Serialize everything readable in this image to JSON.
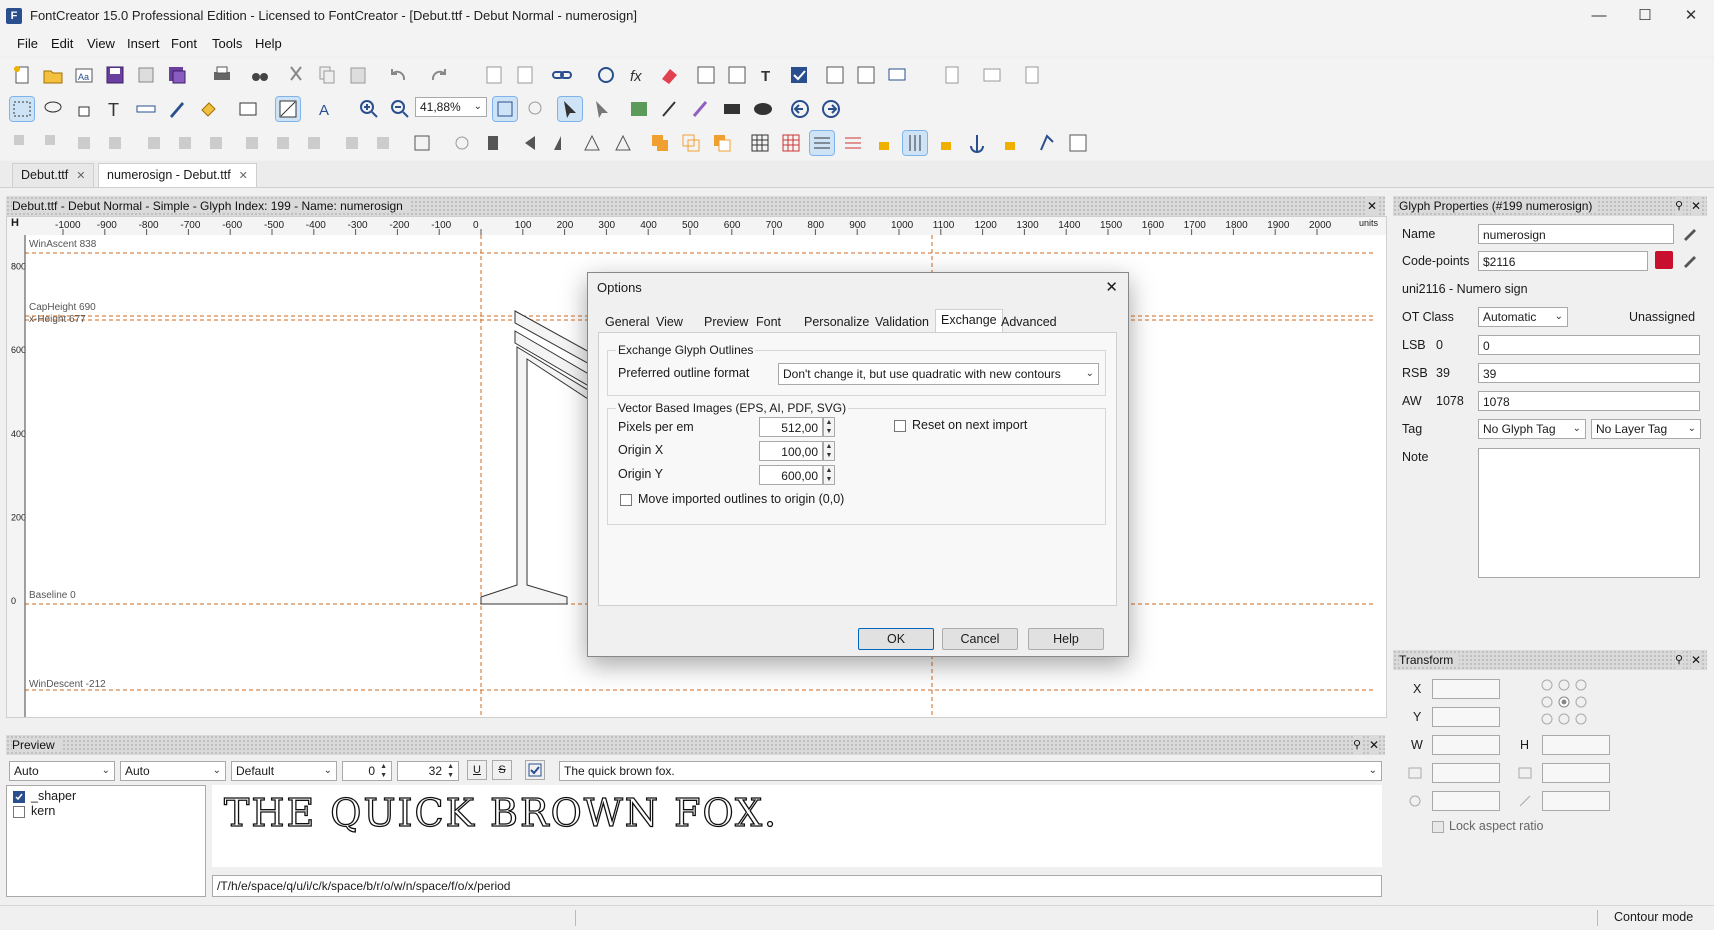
{
  "window": {
    "title": "FontCreator 15.0 Professional Edition - Licensed to FontCreator - [Debut.ttf - Debut Normal - numerosign]",
    "minimize": "—",
    "maximize": "☐",
    "close": "✕"
  },
  "menu": [
    "File",
    "Edit",
    "View",
    "Insert",
    "Font",
    "Tools",
    "Help"
  ],
  "toolbar": {
    "zoom_value": "41,88%"
  },
  "doc_tabs": [
    {
      "label": "Debut.ttf",
      "close": "✕"
    },
    {
      "label": "numerosign - Debut.ttf",
      "close": "✕"
    }
  ],
  "editor": {
    "header": "Debut.ttf - Debut Normal - Simple - Glyph Index: 199 - Name: numerosign",
    "close": "✕",
    "ruler_h_label": "H",
    "ruler_units": "units",
    "ruler_ticks": [
      "-1000",
      "-900",
      "-800",
      "-700",
      "-600",
      "-500",
      "-400",
      "-300",
      "-200",
      "-100",
      "0",
      "100",
      "200",
      "300",
      "400",
      "500",
      "600",
      "700",
      "800",
      "900",
      "1000",
      "1100",
      "1200",
      "1300",
      "1400",
      "1500",
      "1600",
      "1700",
      "1800",
      "1900",
      "2000"
    ],
    "vruler_ticks": [
      "800",
      "600",
      "400",
      "200",
      "0"
    ],
    "guides": {
      "win_ascent": "WinAscent 838",
      "cap_height": "CapHeight 690",
      "x_height": "x-Height 677",
      "baseline": "Baseline 0",
      "win_descent": "WinDescent -212"
    }
  },
  "dialog": {
    "title": "Options",
    "close": "✕",
    "tabs": [
      "General",
      "View",
      "Preview",
      "Font",
      "Personalize",
      "Validation",
      "Exchange",
      "Advanced"
    ],
    "active_tab": "Exchange",
    "glyph_group": "Exchange Glyph Outlines",
    "outline_label": "Preferred outline format",
    "outline_value": "Don't change it, but use quadratic with new contours",
    "vector_group": "Vector Based Images (EPS, AI, PDF, SVG)",
    "pixels_label": "Pixels per em",
    "pixels_value": "512,00",
    "origin_x_label": "Origin X",
    "origin_x_value": "100,00",
    "origin_y_label": "Origin Y",
    "origin_y_value": "600,00",
    "reset_label": "Reset on next import",
    "move_label": "Move imported outlines to origin (0,0)",
    "ok": "OK",
    "cancel": "Cancel",
    "help": "Help"
  },
  "glyph_props": {
    "header": "Glyph Properties (#199 numerosign)",
    "name_label": "Name",
    "name_value": "numerosign",
    "codepoints_label": "Code-points",
    "codepoints_value": "$2116",
    "unicode_name": "uni2116 - Numero sign",
    "otclass_label": "OT Class",
    "otclass_value": "Automatic",
    "otclass_status": "Unassigned",
    "lsb_label": "LSB",
    "lsb_num": "0",
    "lsb_value": "0",
    "rsb_label": "RSB",
    "rsb_num": "39",
    "rsb_value": "39",
    "aw_label": "AW",
    "aw_num": "1078",
    "aw_value": "1078",
    "tag_label": "Tag",
    "glyph_tag": "No Glyph Tag",
    "layer_tag": "No Layer Tag",
    "note_label": "Note"
  },
  "transform": {
    "header": "Transform",
    "x_label": "X",
    "y_label": "Y",
    "w_label": "W",
    "h_label": "H",
    "lock_label": "Lock aspect ratio"
  },
  "preview": {
    "header": "Preview",
    "combo1": "Auto",
    "combo2": "Auto",
    "combo3": "Default",
    "spin1": "0",
    "spin2": "32",
    "text_value": "The quick brown fox.",
    "features": [
      "_shaper",
      "kern"
    ],
    "rendered": "THE QUICK BROWN FOX.",
    "glyph_string": "/T/h/e/space/q/u/i/c/k/space/b/r/o/w/n/space/f/o/x/period"
  },
  "status": {
    "mode": "Contour mode"
  }
}
